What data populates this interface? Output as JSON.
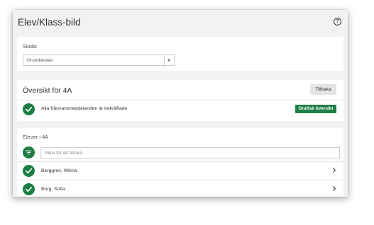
{
  "app": {
    "title": "Elev/Klass-bild"
  },
  "school": {
    "label": "Skola:",
    "selected": "Grundskolan"
  },
  "overview": {
    "title": "Översikt för 4A",
    "back_label": "Tillbaka",
    "status_text": "Alla frånvaromeddelanden är bekräftade",
    "graphic_label": "Grafisk översikt"
  },
  "students": {
    "heading": "Elever i 4A",
    "filter_placeholder": "Skriv för att filtrera",
    "items": [
      {
        "name": "Berggren, Wilma"
      },
      {
        "name": "Borg, Sofia"
      }
    ]
  },
  "colors": {
    "accent": "#1e7e45",
    "background": "#f2f2f2",
    "card": "#ffffff"
  },
  "icons": {
    "help": "question-circle-icon",
    "check": "check-circle-icon",
    "filter": "filter-icon",
    "chevron": "chevron-right-icon",
    "caret": "caret-down-icon"
  }
}
